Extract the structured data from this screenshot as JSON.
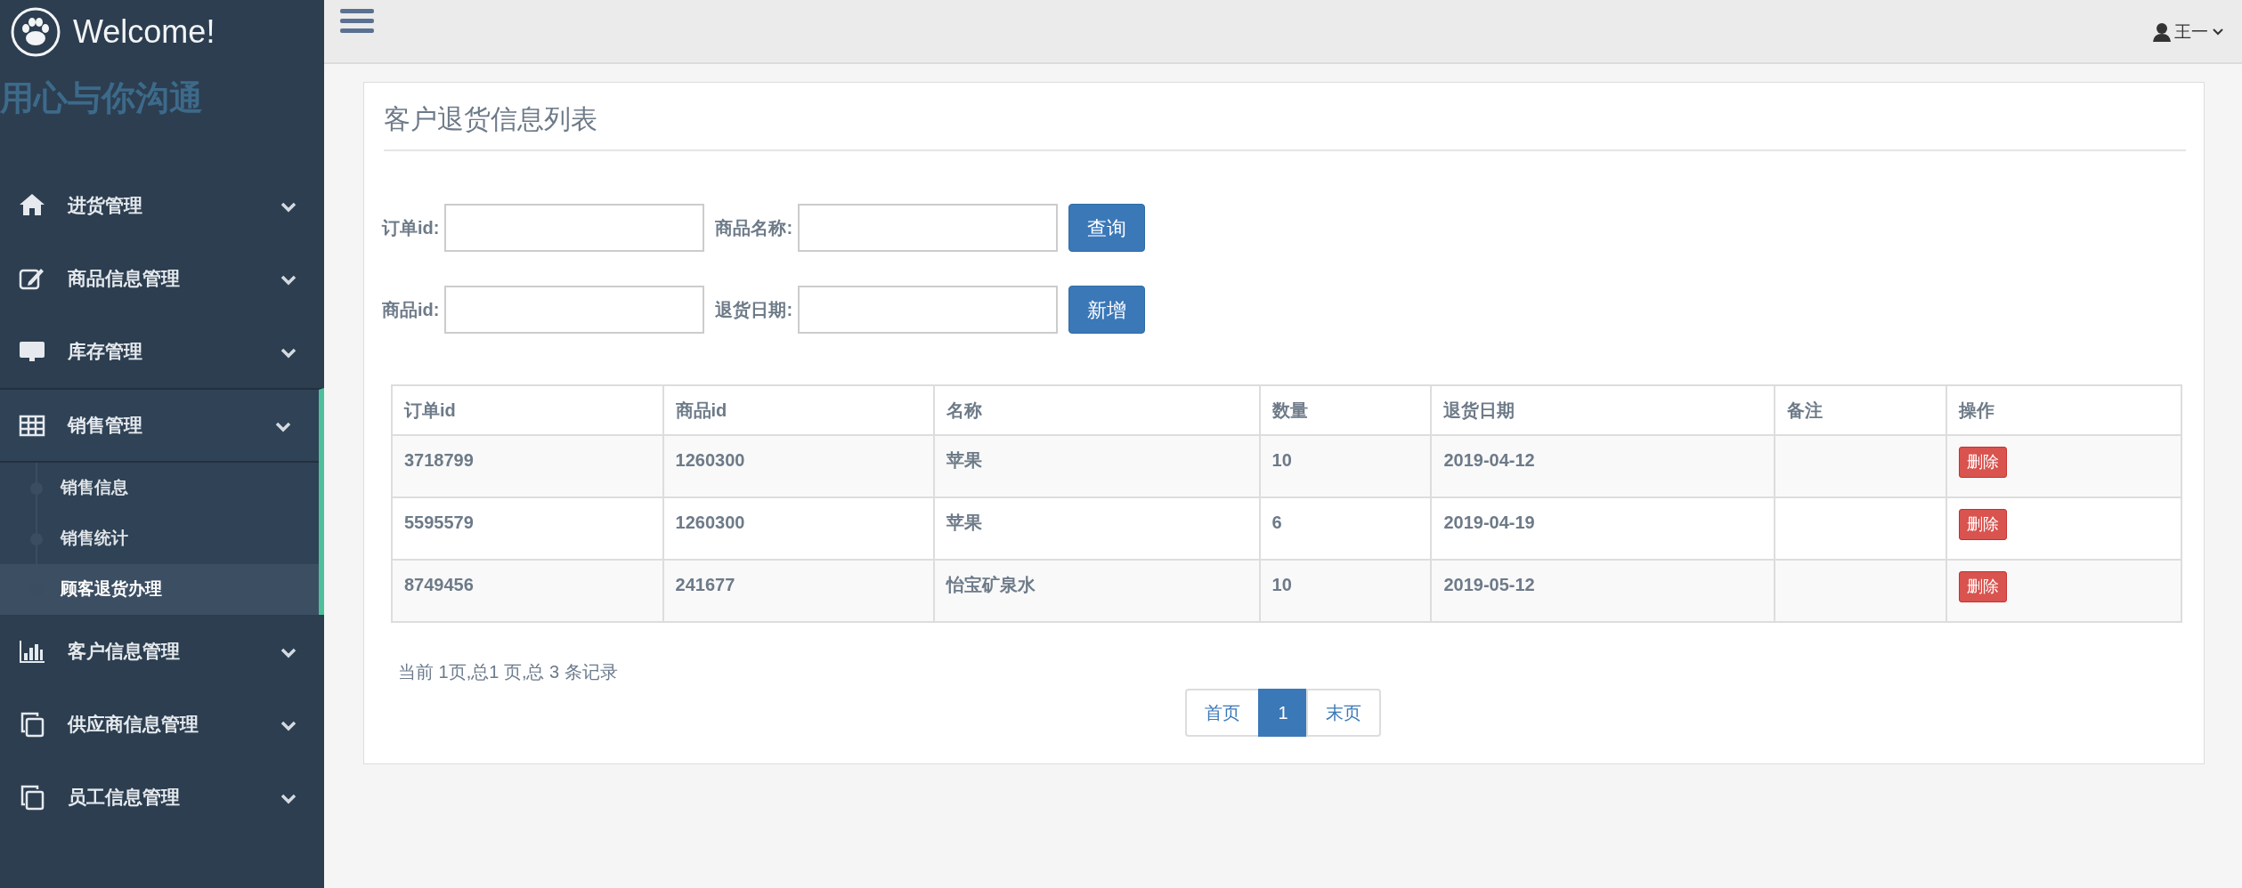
{
  "sidebar": {
    "brand": "Welcome!",
    "slogan": "用心与你沟通",
    "items": [
      {
        "label": "进货管理",
        "expanded": false
      },
      {
        "label": "商品信息管理",
        "expanded": false
      },
      {
        "label": "库存管理",
        "expanded": false
      },
      {
        "label": "销售管理",
        "expanded": true,
        "children": [
          {
            "label": "销售信息",
            "selected": false
          },
          {
            "label": "销售统计",
            "selected": false
          },
          {
            "label": "顾客退货办理",
            "selected": true
          }
        ]
      },
      {
        "label": "客户信息管理",
        "expanded": false
      },
      {
        "label": "供应商信息管理",
        "expanded": false
      },
      {
        "label": "员工信息管理",
        "expanded": false
      }
    ]
  },
  "header": {
    "user": "王一"
  },
  "panel": {
    "title": "客户退货信息列表",
    "filters": [
      [
        {
          "label": "订单id:"
        },
        {
          "label": "商品名称:"
        }
      ],
      [
        {
          "label": "商品id:"
        },
        {
          "label": "退货日期:"
        }
      ]
    ],
    "buttons": [
      "查询",
      "新增"
    ],
    "table": {
      "columns": [
        "订单id",
        "商品id",
        "名称",
        "数量",
        "退货日期",
        "备注",
        "操作"
      ],
      "rows": [
        {
          "cells": [
            "3718799",
            "1260300",
            "苹果",
            "10",
            "2019-04-12",
            ""
          ],
          "action": "删除"
        },
        {
          "cells": [
            "5595579",
            "1260300",
            "苹果",
            "6",
            "2019-04-19",
            ""
          ],
          "action": "删除"
        },
        {
          "cells": [
            "8749456",
            "241677",
            "怡宝矿泉水",
            "10",
            "2019-05-12",
            ""
          ],
          "action": "删除"
        }
      ]
    },
    "summary": "当前 1页,总1 页,总 3 条记录",
    "pagination": [
      {
        "label": "首页",
        "selected": false
      },
      {
        "label": "1",
        "selected": true
      },
      {
        "label": "末页",
        "selected": false
      }
    ]
  }
}
